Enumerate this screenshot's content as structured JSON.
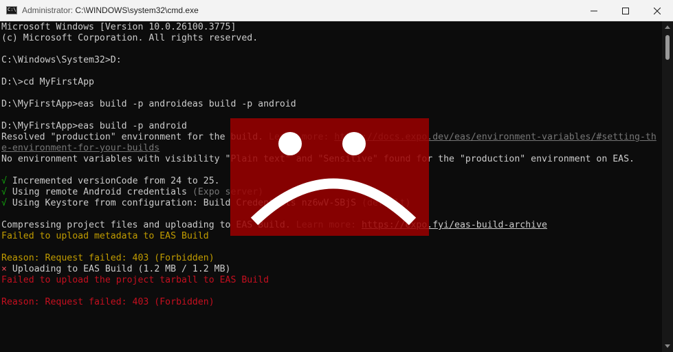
{
  "window": {
    "admin_label": "Administrator:",
    "path": "C:\\WINDOWS\\system32\\cmd.exe",
    "icon_text": "C:\\",
    "controls": {
      "minimize": "minimize-icon",
      "maximize": "maximize-icon",
      "close": "close-icon"
    }
  },
  "console": {
    "lines": [
      {
        "segments": [
          {
            "text": "Microsoft Windows [Version 10.0.26100.3775]"
          }
        ]
      },
      {
        "segments": [
          {
            "text": "(c) Microsoft Corporation. All rights reserved."
          }
        ]
      },
      {
        "segments": [
          {
            "text": ""
          }
        ]
      },
      {
        "segments": [
          {
            "text": "C:\\Windows\\System32>D:"
          }
        ]
      },
      {
        "segments": [
          {
            "text": ""
          }
        ]
      },
      {
        "segments": [
          {
            "text": "D:\\>cd MyFirstApp"
          }
        ]
      },
      {
        "segments": [
          {
            "text": ""
          }
        ]
      },
      {
        "segments": [
          {
            "text": "D:\\MyFirstApp>eas build -p androideas build -p android"
          }
        ]
      },
      {
        "segments": [
          {
            "text": ""
          }
        ]
      },
      {
        "segments": [
          {
            "text": "D:\\MyFirstApp>eas build -p android"
          }
        ]
      },
      {
        "segments": [
          {
            "text": "Resolved \"production\" environment for the build. "
          },
          {
            "text": "Learn more: ",
            "style": "dim"
          },
          {
            "text": "https://docs.expo.dev/eas/environment-variables/#setting-th",
            "style": "linkdim"
          }
        ]
      },
      {
        "segments": [
          {
            "text": "e-environment-for-your-builds",
            "style": "linkdim"
          }
        ]
      },
      {
        "segments": [
          {
            "text": "No environment variables with visibility \"Plain text\" and \"Sensitive\" found for the \"production\" environment on EAS."
          }
        ]
      },
      {
        "segments": [
          {
            "text": ""
          }
        ]
      },
      {
        "segments": [
          {
            "text": "√",
            "style": "green"
          },
          {
            "text": " Incremented versionCode from 24 to 25."
          }
        ]
      },
      {
        "segments": [
          {
            "text": "√",
            "style": "green"
          },
          {
            "text": " Using remote Android credentials "
          },
          {
            "text": "(Expo server)",
            "style": "dim"
          }
        ]
      },
      {
        "segments": [
          {
            "text": "√",
            "style": "green"
          },
          {
            "text": " Using Keystore from configuration: Build Credentials nz6wV-SBjS "
          },
          {
            "text": "(default)",
            "style": "dim"
          }
        ]
      },
      {
        "segments": [
          {
            "text": ""
          }
        ]
      },
      {
        "segments": [
          {
            "text": "Compressing project files and uploading to EAS Build. "
          },
          {
            "text": "Learn more: ",
            "style": "dim"
          },
          {
            "text": "https://expo.fyi/eas-build-archive",
            "style": "link"
          }
        ]
      },
      {
        "segments": [
          {
            "text": "Failed to upload metadata to EAS Build",
            "style": "yellow"
          }
        ]
      },
      {
        "segments": [
          {
            "text": ""
          }
        ]
      },
      {
        "segments": [
          {
            "text": "Reason: Request failed: 403 (Forbidden)",
            "style": "yellow"
          }
        ]
      },
      {
        "segments": [
          {
            "text": "×",
            "style": "red"
          },
          {
            "text": " Uploading to EAS Build (1.2 MB / 1.2 MB)"
          }
        ]
      },
      {
        "segments": [
          {
            "text": "Failed to upload the project tarball to EAS Build",
            "style": "red2"
          }
        ]
      },
      {
        "segments": [
          {
            "text": ""
          }
        ]
      },
      {
        "segments": [
          {
            "text": "Reason: Request failed: 403 (Forbidden)",
            "style": "red2"
          }
        ]
      }
    ]
  },
  "overlay": {
    "icon": "sad-face-icon",
    "color": "#9b0000"
  }
}
